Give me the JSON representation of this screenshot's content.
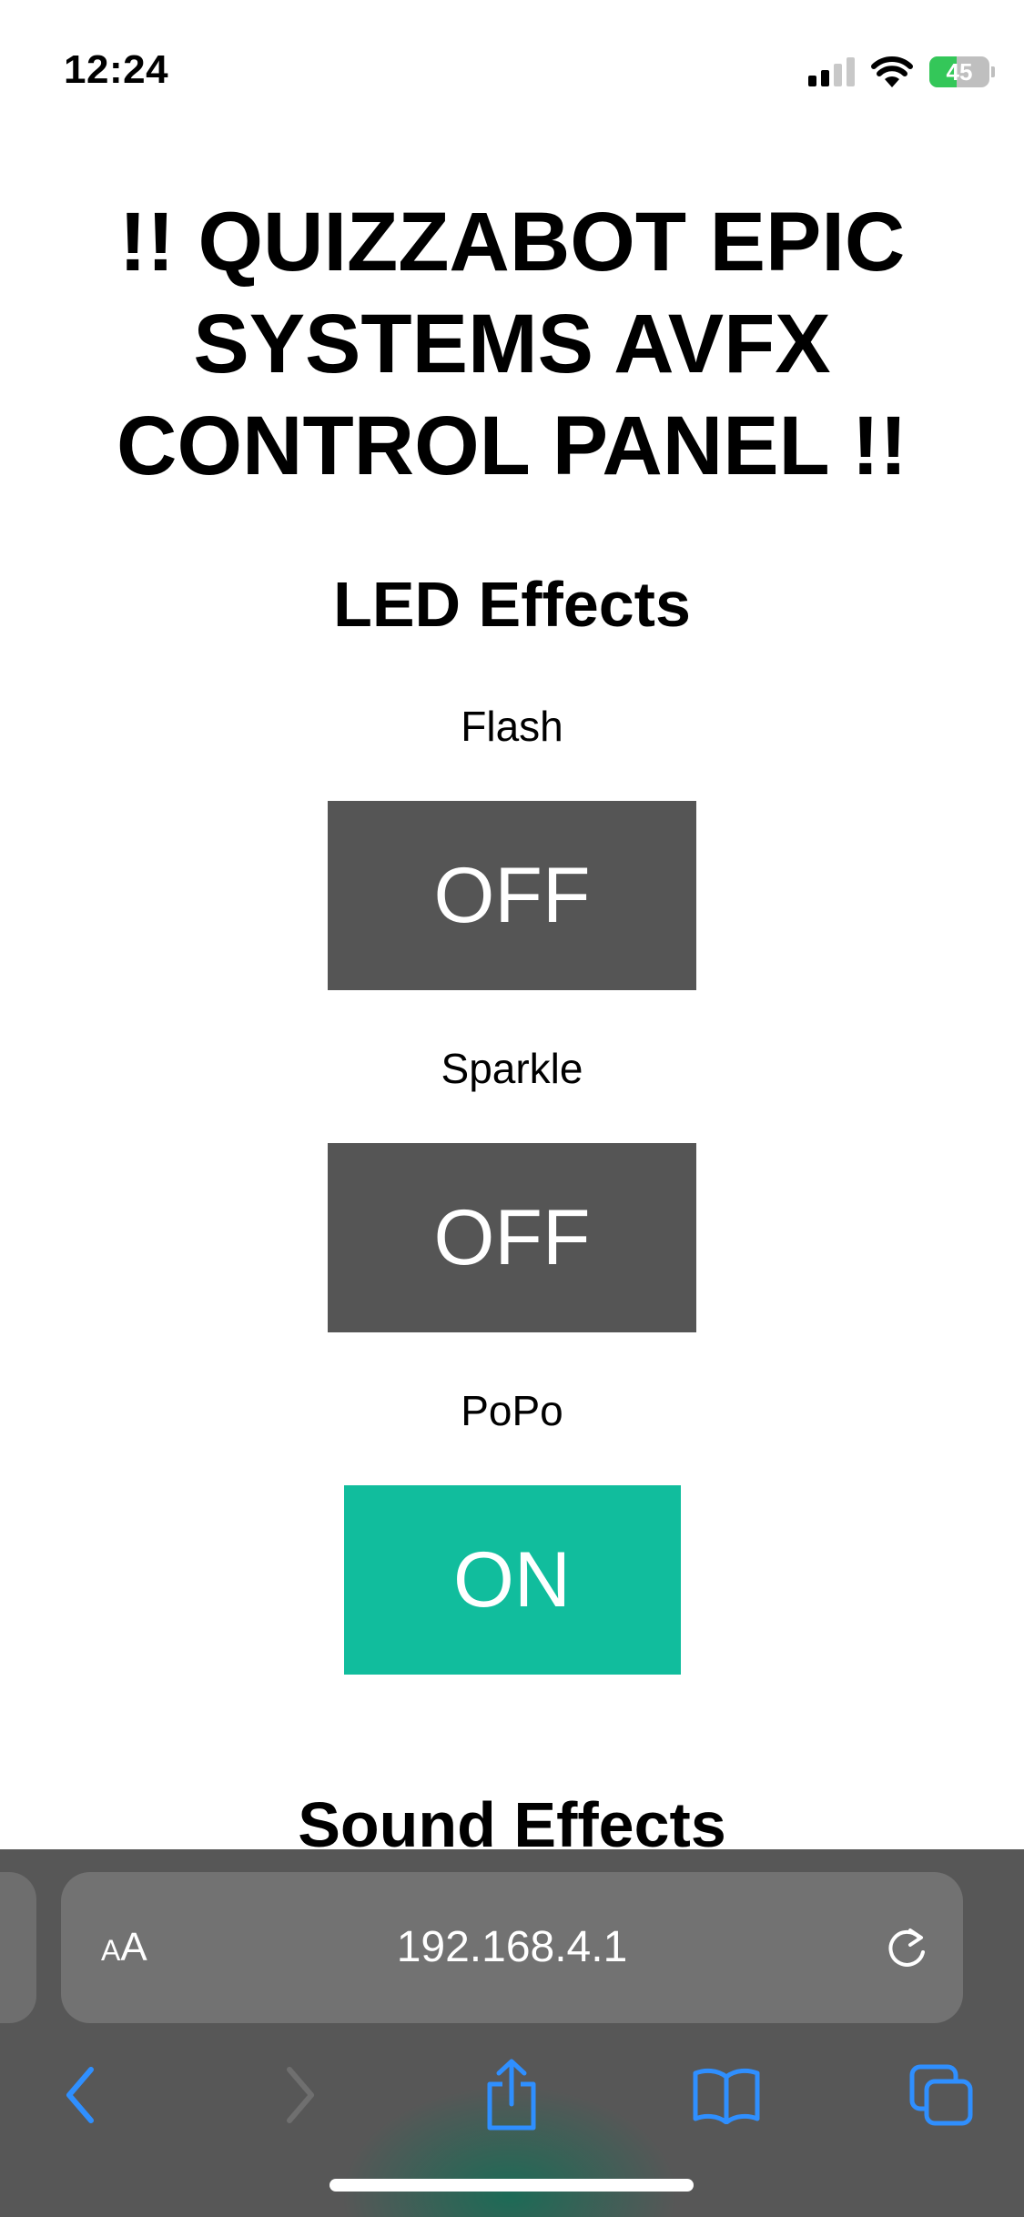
{
  "status_bar": {
    "time": "12:24",
    "battery_percent": "45",
    "battery_level": 0.45,
    "icons": [
      "cellular-signal-icon",
      "wifi-icon",
      "battery-charging-icon"
    ]
  },
  "page": {
    "title": "!! QUIZZABOT EPIC SYSTEMS AVFX CONTROL PANEL !!",
    "led_section_title": "LED Effects",
    "effects": [
      {
        "label": "Flash",
        "state": "OFF"
      },
      {
        "label": "Sparkle",
        "state": "OFF"
      },
      {
        "label": "PoPo",
        "state": "ON"
      }
    ],
    "next_section_title": "Sound Effects"
  },
  "browser": {
    "text_size_small": "A",
    "text_size_large": "A",
    "url": "192.168.4.1",
    "toolbar_icons": [
      "back-icon",
      "forward-icon",
      "share-icon",
      "bookmarks-icon",
      "tabs-icon"
    ]
  },
  "colors": {
    "toggle_off": "#555555",
    "toggle_on": "#11bd9d",
    "browser_accent": "#2f8fff",
    "battery_green": "#34c759",
    "toolbar_bg": "#575757"
  }
}
